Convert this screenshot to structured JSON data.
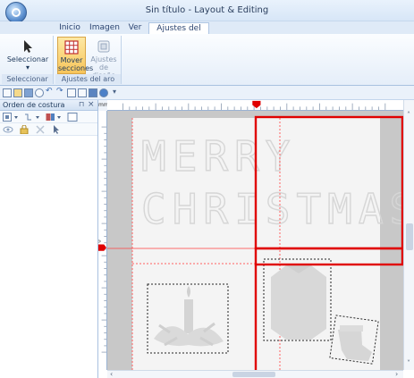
{
  "window": {
    "title": "Sin título - Layout & Editing"
  },
  "tabs": [
    {
      "label": "Inicio",
      "active": false
    },
    {
      "label": "Imagen",
      "active": false
    },
    {
      "label": "Ver",
      "active": false
    },
    {
      "label": "Ajustes del aro",
      "active": true
    }
  ],
  "ribbon": {
    "select_group": {
      "label": "Seleccionar",
      "button": "Seleccionar",
      "sub": "▾"
    },
    "hoop_group": {
      "label": "Ajustes del aro",
      "move_sections": "Mover secciones",
      "design_settings": "Ajustes de diseño"
    }
  },
  "quick_access": {
    "icons": [
      "new-icon",
      "open-icon",
      "save-icon",
      "zoom-icon",
      "undo-icon",
      "redo-icon",
      "layout-icon",
      "fit-icon",
      "hoop-icon",
      "help-icon"
    ],
    "more": "▾"
  },
  "pane": {
    "title": "Orden de costura",
    "pin": "⊓",
    "close": "×"
  },
  "ruler": {
    "corner": "mm"
  },
  "design": {
    "line1": "MERRY",
    "line2": "CHRISTMAS"
  },
  "colors": {
    "hoop_border": "#e00000",
    "guide": "#ff4040",
    "accent_tab": "#f7c55a"
  }
}
